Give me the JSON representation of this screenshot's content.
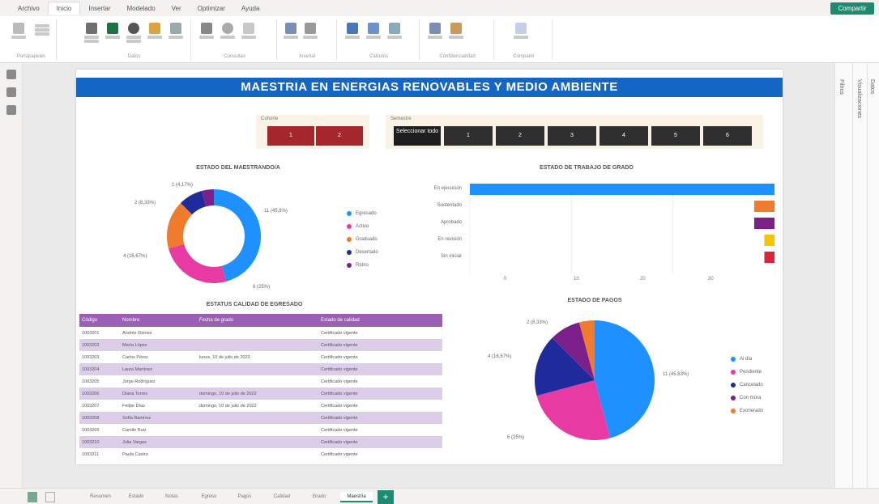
{
  "ribbon_tabs": [
    "Archivo",
    "Inicio",
    "Insertar",
    "Modelado",
    "Ver",
    "Optimizar",
    "Ayuda"
  ],
  "active_ribbon_tab": 1,
  "share_label": "Compartir",
  "ribbon_groups": [
    "Portapapeles",
    "Datos",
    "Consultas",
    "Insertar",
    "Cálculos",
    "Confidencialidad",
    "Compartir"
  ],
  "right_panes": [
    "Datos",
    "Visualizaciones",
    "Filtros"
  ],
  "report": {
    "title": "MAESTRIA EN ENERGIAS RENOVABLES Y MEDIO AMBIENTE",
    "slicer1": {
      "title": "Cohorte",
      "buttons": [
        "1",
        "2"
      ]
    },
    "slicer2": {
      "title": "Semestre",
      "buttons": [
        "Seleccionar todo",
        "1",
        "2",
        "3",
        "4",
        "5",
        "6"
      ]
    },
    "donut": {
      "title": "ESTADO DEL MAESTRANDO/A",
      "legend": [
        "Egresado",
        "Activo",
        "Graduado",
        "Desertado",
        "Retiro"
      ],
      "labels": [
        "11 (45,8%)",
        "6 (25%)",
        "4 (16,67%)",
        "2 (8,33%)",
        "1 (4,17%)"
      ]
    },
    "bar": {
      "title": "ESTADO DE TRABAJO DE GRADO",
      "x_ticks": [
        "0",
        "10",
        "20",
        "30"
      ]
    },
    "pie": {
      "title": "ESTADO DE PAGOS",
      "legend": [
        "Al día",
        "Pendiente",
        "Cancelado",
        "Con mora",
        "Exonerado"
      ],
      "labels": [
        "11 (45,83%)",
        "6 (25%)",
        "4 (16,67%)",
        "2 (8,33%)"
      ]
    },
    "table": {
      "title": "ESTATUS CALIDAD DE EGRESADO",
      "headers": [
        "Código",
        "Nombre",
        "Fecha de grado",
        "Estado de calidad"
      ],
      "rows": [
        [
          "1003201",
          "Andrés Gómez",
          "",
          "Certificado vigente"
        ],
        [
          "1003202",
          "María López",
          "",
          "Certificado vigente"
        ],
        [
          "1003203",
          "Carlos Pérez",
          "lunes, 10 de julio de 2023",
          "Certificado vigente"
        ],
        [
          "1003204",
          "Laura Martínez",
          "",
          "Certificado vigente"
        ],
        [
          "1003205",
          "Jorge Rodríguez",
          "",
          "Certificado vigente"
        ],
        [
          "1003206",
          "Diana Torres",
          "domingo, 10 de julio de 2022",
          "Certificado vigente"
        ],
        [
          "1003207",
          "Felipe Díaz",
          "domingo, 10 de julio de 2022",
          "Certificado vigente"
        ],
        [
          "1003208",
          "Sofía Ramírez",
          "",
          "Certificado vigente"
        ],
        [
          "1003209",
          "Camilo Ruiz",
          "",
          "Certificado vigente"
        ],
        [
          "1003210",
          "Julia Vargas",
          "",
          "Certificado vigente"
        ],
        [
          "1003211",
          "Paula Castro",
          "",
          "Certificado vigente"
        ]
      ]
    }
  },
  "pages": [
    "Resumen",
    "Estado",
    "Notas",
    "Egreso",
    "Pagos",
    "Calidad",
    "Grado",
    "Maestría"
  ],
  "active_page": 7,
  "colors": {
    "blue": "#1e90ff",
    "pink": "#e83aa3",
    "orange": "#f07a2e",
    "navy": "#1f2a9c",
    "purple": "#7b1f8a",
    "yellow": "#f2c500",
    "red": "#d7263d",
    "banner": "#1466c4",
    "table_header": "#9b5fb3",
    "table_alt": "#dccdeb"
  },
  "chart_data": [
    {
      "type": "pie",
      "title": "ESTADO DEL MAESTRANDO/A",
      "categories": [
        "Egresado",
        "Activo",
        "Graduado",
        "Desertado",
        "Retiro"
      ],
      "values": [
        11,
        6,
        4,
        2,
        1
      ],
      "colors": [
        "#1e90ff",
        "#e83aa3",
        "#f07a2e",
        "#1f2a9c",
        "#7b1f8a"
      ],
      "donut": true
    },
    {
      "type": "bar",
      "title": "ESTADO DE TRABAJO DE GRADO",
      "orientation": "horizontal",
      "categories": [
        "En ejecución",
        "Sustentado",
        "Aprobado",
        "En revisión",
        "Sin iniciar"
      ],
      "values": [
        30,
        2,
        2,
        1,
        1
      ],
      "colors": [
        "#1e90ff",
        "#f07a2e",
        "#7b1f8a",
        "#f2c500",
        "#d7263d"
      ],
      "xlim": [
        0,
        30
      ]
    },
    {
      "type": "pie",
      "title": "ESTADO DE PAGOS",
      "categories": [
        "Al día",
        "Pendiente",
        "Cancelado",
        "Con mora",
        "Exonerado"
      ],
      "values": [
        11,
        6,
        4,
        2,
        1
      ],
      "colors": [
        "#1e90ff",
        "#e83aa3",
        "#1f2a9c",
        "#7b1f8a",
        "#f07a2e"
      ]
    }
  ]
}
